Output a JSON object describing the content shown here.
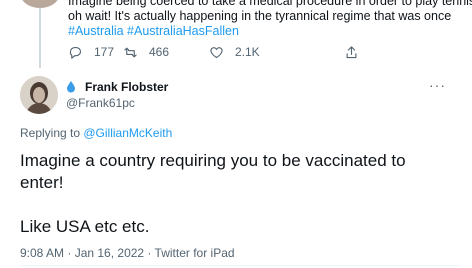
{
  "parent": {
    "line1": "Imagine being coerced to take a medical procedure in order to play tennis...",
    "line2": "oh wait! It's actually happening in the tyrannical regime that was once",
    "hashtags": "#Australia #AustraliaHasFallen",
    "reply_count": "177",
    "retweet_count": "466",
    "like_count": "2.1K"
  },
  "tweet": {
    "name": "Frank Flobster",
    "handle": "@Frank61pc",
    "replying_prefix": "Replying to ",
    "replying_to": "@GillianMcKeith",
    "text_line1": "Imagine a country requiring you to be vaccinated to",
    "text_line2": "enter!",
    "text_line3": "Like USA etc etc.",
    "timestamp": "9:08 AM · Jan 16, 2022 · Twitter for iPad",
    "more_label": "···"
  },
  "colors": {
    "link": "#1d9bf0",
    "muted": "#536471",
    "text": "#0f1419"
  },
  "icons": {
    "reply": "reply-icon",
    "retweet": "retweet-icon",
    "like": "heart-icon",
    "share": "share-icon",
    "drop": "water-drop-icon",
    "more": "more-icon"
  }
}
